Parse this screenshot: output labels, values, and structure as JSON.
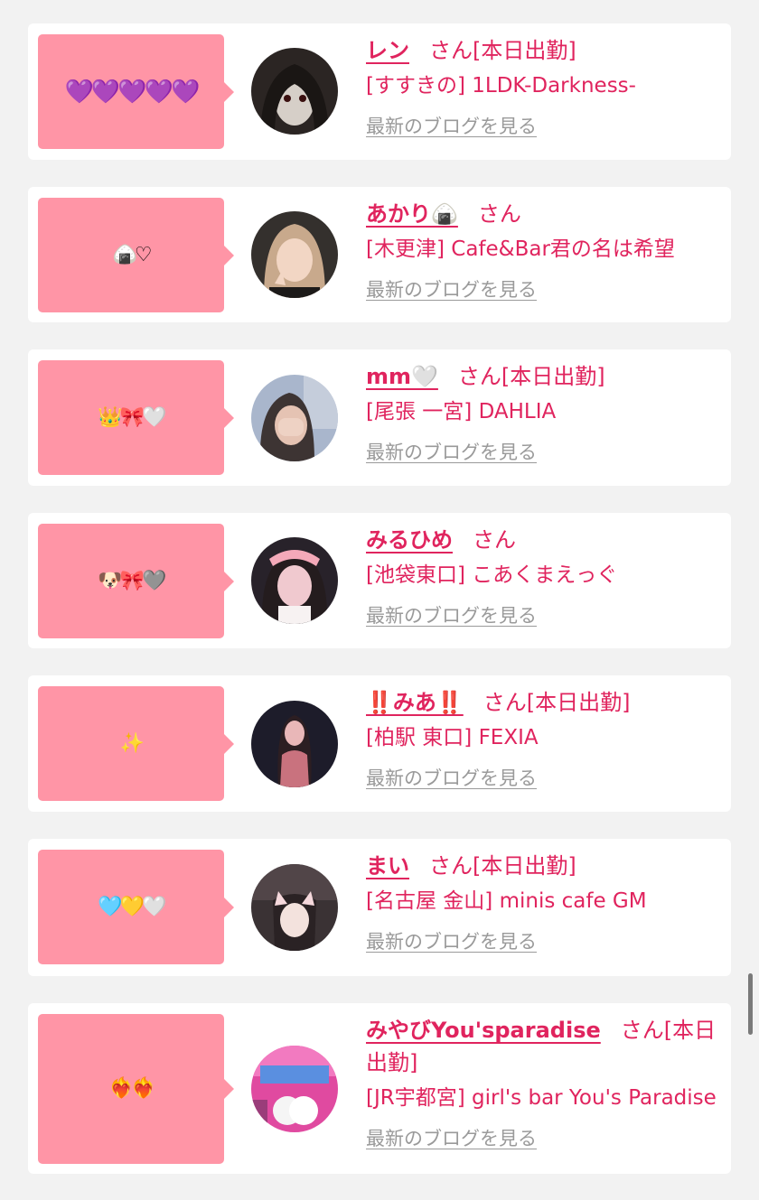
{
  "cards": [
    {
      "bubble": "💜💜💜💜💜",
      "name": "レン",
      "suffix": "さん[本日出勤]",
      "shop": "[すすきの] 1LDK-Darkness-",
      "blog": "最新のブログを見る",
      "avatar_colors": [
        "#2b2523",
        "#d6cfc8"
      ]
    },
    {
      "bubble": "🍙♡",
      "name": "あかり🍙",
      "suffix": "さん",
      "shop": "[木更津] Cafe&Bar君の名は希望",
      "blog": "最新のブログを見る",
      "avatar_colors": [
        "#34302d",
        "#f2d6c4"
      ]
    },
    {
      "bubble": "👑🎀🤍",
      "name": "mm🤍",
      "suffix": "さん[本日出勤]",
      "shop": "[尾張 一宮] DAHLIA",
      "blog": "最新のブログを見る",
      "avatar_colors": [
        "#a9b6cc",
        "#e5c3b3"
      ]
    },
    {
      "bubble": "🐶🎀🩶",
      "name": "みるひめ",
      "suffix": "さん",
      "shop": "[池袋東口] こあくまえっぐ",
      "blog": "最新のブログを見る",
      "avatar_colors": [
        "#28222a",
        "#f0c9cf"
      ]
    },
    {
      "bubble": "✨",
      "name": "‼️みあ‼️",
      "suffix": "さん[本日出勤]",
      "shop": "[柏駅 東口] FEXIA",
      "blog": "最新のブログを見る",
      "avatar_colors": [
        "#1d1c2a",
        "#e9b7b8"
      ]
    },
    {
      "bubble": "🩵💛🤍",
      "name": "まい",
      "suffix": "さん[本日出勤]",
      "shop": "[名古屋 金山] minis cafe GM",
      "blog": "最新のブログを見る",
      "avatar_colors": [
        "#3a3234",
        "#f3e2dd"
      ]
    },
    {
      "bubble": "❤️‍🔥❤️‍🔥",
      "name": "みやびYou'sparadise",
      "suffix": "さん[本日出勤]",
      "shop": "[JR宇都宮] girl's bar You's Paradise",
      "blog": "最新のブログを見る",
      "avatar_colors": [
        "#e04aa0",
        "#f5f5f5"
      ]
    }
  ]
}
